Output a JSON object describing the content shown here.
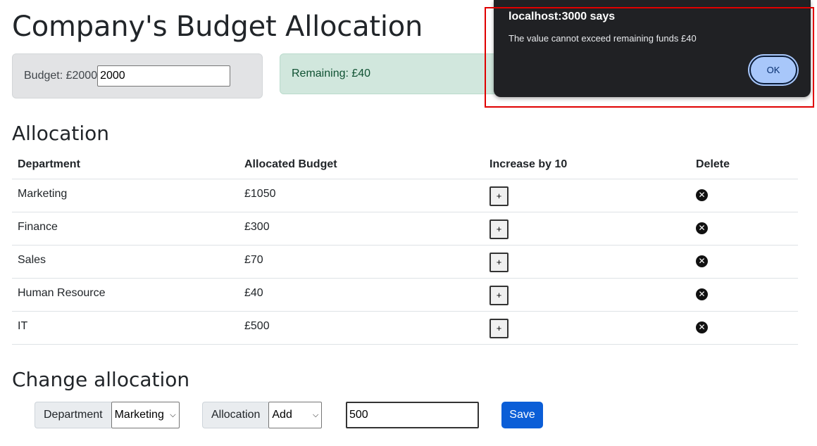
{
  "page": {
    "title": "Company's Budget Allocation"
  },
  "budget": {
    "label": "Budget: £2000",
    "input_value": "2000"
  },
  "remaining": {
    "label": "Remaining: £40"
  },
  "allocation": {
    "heading": "Allocation",
    "columns": {
      "department": "Department",
      "allocated": "Allocated Budget",
      "increase": "Increase by 10",
      "delete": "Delete"
    },
    "rows": [
      {
        "department": "Marketing",
        "budget": "£1050"
      },
      {
        "department": "Finance",
        "budget": "£300"
      },
      {
        "department": "Sales",
        "budget": "£70"
      },
      {
        "department": "Human Resource",
        "budget": "£40"
      },
      {
        "department": "IT",
        "budget": "£500"
      }
    ],
    "increase_label": "+",
    "delete_icon": "close-circle-icon"
  },
  "change": {
    "heading": "Change allocation",
    "department_label": "Department",
    "department_selected": "Marketing",
    "allocation_label": "Allocation",
    "allocation_selected": "Add",
    "amount_value": "500",
    "save_label": "Save"
  },
  "dialog": {
    "title": "localhost:3000 says",
    "message": "The value cannot exceed remaining funds  £40",
    "ok_label": "OK"
  },
  "colors": {
    "primary": "#0b5ed7",
    "success_bg": "#d1e7dd",
    "secondary_bg": "#e2e3e5",
    "dialog_bg": "#202124",
    "ok_button": "#a8c7fa",
    "highlight": "#e00000"
  }
}
